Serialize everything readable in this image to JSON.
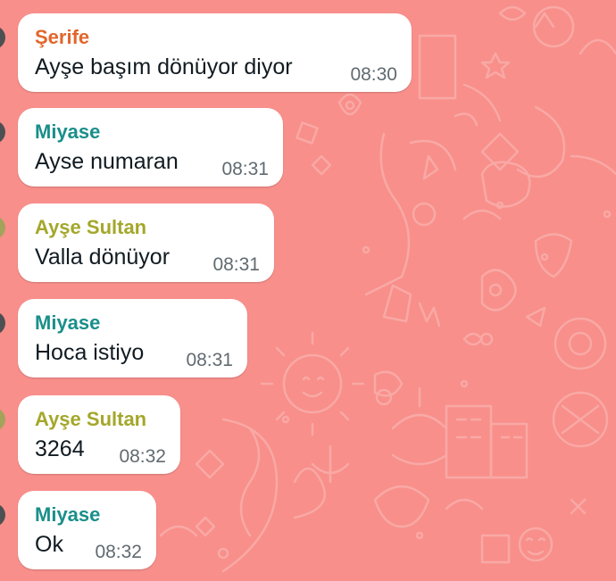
{
  "colors": {
    "wallpaper": "#f88f8b",
    "wallpaper_doodle": "#f9a9a5",
    "bubble": "#ffffff",
    "message_text": "#111b21",
    "timestamp": "#606a70",
    "sender_serife": "#e2662c",
    "sender_miyase": "#1a8f8a",
    "sender_ayse_sultan": "#a4a72a"
  },
  "messages": [
    {
      "sender": "Şerife",
      "text": "Ayşe başım dönüyor diyor",
      "time": "08:30"
    },
    {
      "sender": "Miyase",
      "text": "Ayse numaran",
      "time": "08:31"
    },
    {
      "sender": "Ayşe Sultan",
      "text": "Valla dönüyor",
      "time": "08:31"
    },
    {
      "sender": "Miyase",
      "text": "Hoca istiyo",
      "time": "08:31"
    },
    {
      "sender": "Ayşe Sultan",
      "text": "3264",
      "time": "08:32"
    },
    {
      "sender": "Miyase",
      "text": "Ok",
      "time": "08:32"
    }
  ]
}
